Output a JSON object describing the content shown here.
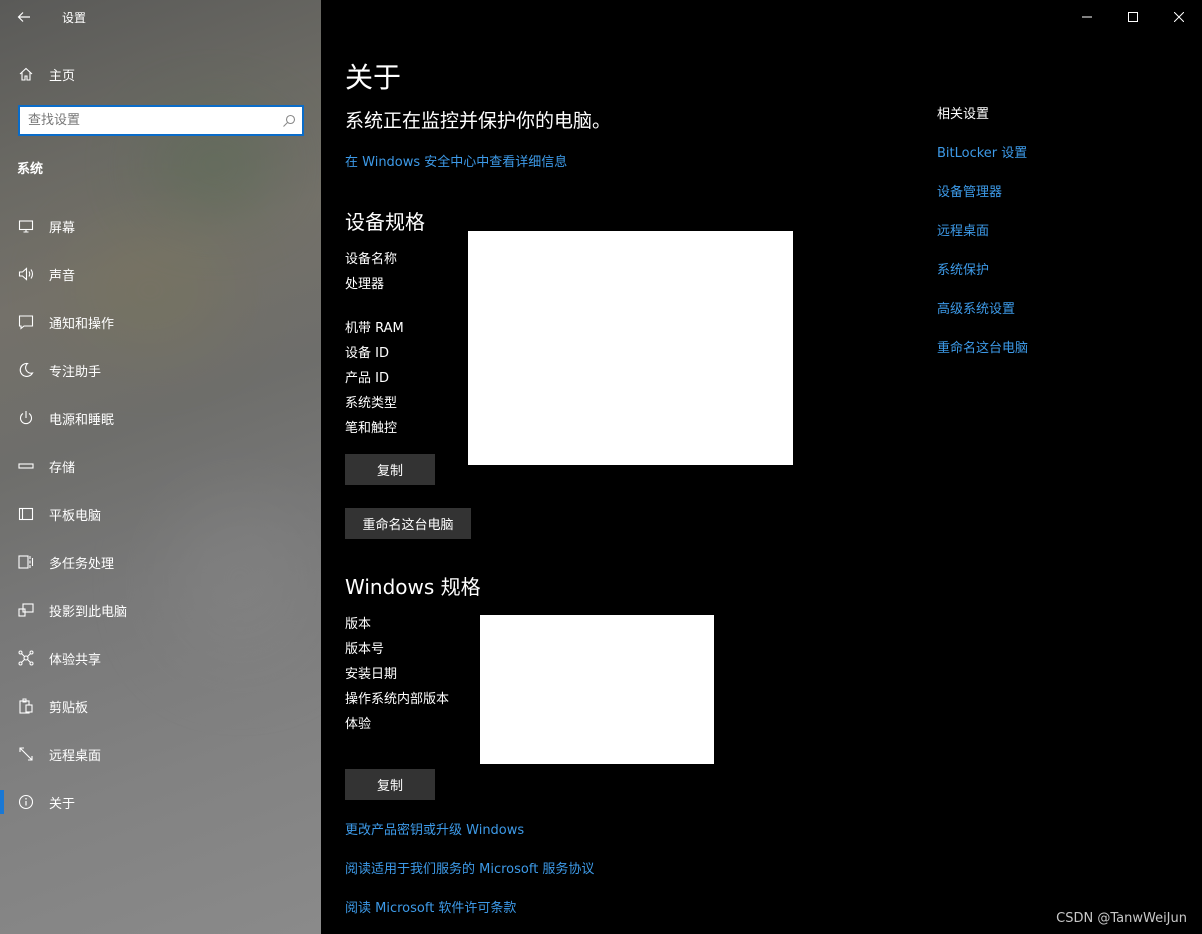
{
  "window": {
    "title": "设置",
    "controls": [
      "minimize",
      "maximize",
      "close"
    ]
  },
  "sidebar": {
    "home_label": "主页",
    "search_placeholder": "查找设置",
    "section_title": "系统",
    "items": [
      {
        "label": "屏幕",
        "icon": "display-icon"
      },
      {
        "label": "声音",
        "icon": "speaker-icon"
      },
      {
        "label": "通知和操作",
        "icon": "notification-icon"
      },
      {
        "label": "专注助手",
        "icon": "moon-icon"
      },
      {
        "label": "电源和睡眠",
        "icon": "power-icon"
      },
      {
        "label": "存储",
        "icon": "storage-icon"
      },
      {
        "label": "平板电脑",
        "icon": "tablet-icon"
      },
      {
        "label": "多任务处理",
        "icon": "multitask-icon"
      },
      {
        "label": "投影到此电脑",
        "icon": "project-icon"
      },
      {
        "label": "体验共享",
        "icon": "share-icon"
      },
      {
        "label": "剪贴板",
        "icon": "clipboard-icon"
      },
      {
        "label": "远程桌面",
        "icon": "remote-icon"
      },
      {
        "label": "关于",
        "icon": "info-icon",
        "active": true
      }
    ]
  },
  "main": {
    "title": "关于",
    "protect_text": "系统正在监控并保护你的电脑。",
    "security_link": "在 Windows 安全中心中查看详细信息",
    "device_specs": {
      "heading": "设备规格",
      "labels": [
        "设备名称",
        "处理器",
        "机带 RAM",
        "设备 ID",
        "产品 ID",
        "系统类型",
        "笔和触控"
      ],
      "copy_button": "复制",
      "rename_button": "重命名这台电脑"
    },
    "windows_specs": {
      "heading": "Windows 规格",
      "labels": [
        "版本",
        "版本号",
        "安装日期",
        "操作系统内部版本",
        "体验"
      ],
      "copy_button": "复制"
    },
    "bottom_links": [
      "更改产品密钥或升级 Windows",
      "阅读适用于我们服务的 Microsoft 服务协议",
      "阅读 Microsoft 软件许可条款"
    ]
  },
  "related": {
    "heading": "相关设置",
    "links": [
      "BitLocker 设置",
      "设备管理器",
      "远程桌面",
      "系统保护",
      "高级系统设置",
      "重命名这台电脑"
    ]
  },
  "watermark": "CSDN @TanwWeiJun",
  "colors": {
    "accent": "#3d9ae8",
    "active_indicator": "#1a78d4",
    "button_bg": "#333333",
    "main_bg": "#000000"
  }
}
